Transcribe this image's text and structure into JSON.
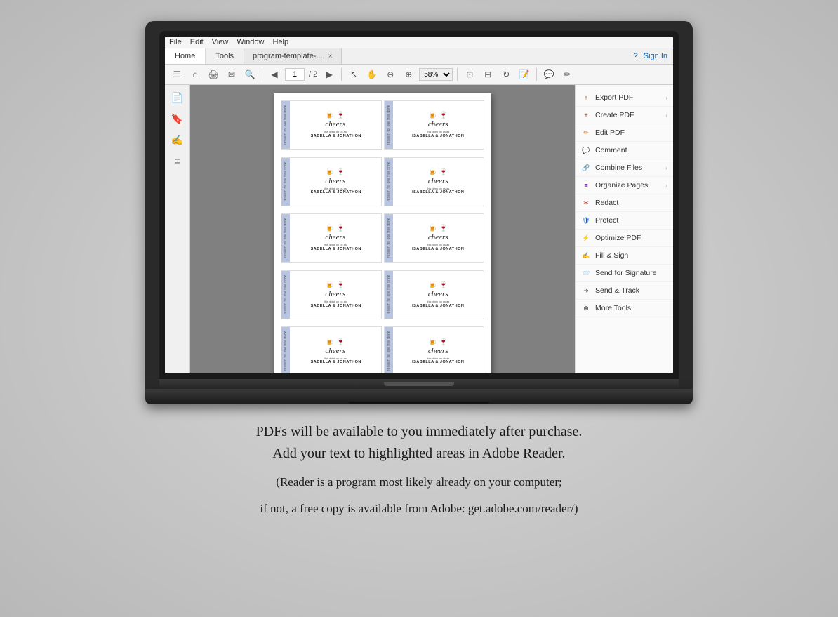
{
  "laptop": {
    "screen": {
      "menubar": {
        "items": [
          "File",
          "Edit",
          "View",
          "Window",
          "Help"
        ]
      },
      "tabs": {
        "home": "Home",
        "tools": "Tools",
        "file": "program-template-...",
        "close": "×"
      },
      "signin": {
        "help": "?",
        "label": "Sign In"
      },
      "toolbar": {
        "page_current": "1",
        "page_total": "/ 2",
        "zoom": "58%"
      },
      "right_panel": {
        "items": [
          {
            "label": "Export PDF",
            "icon": "📤",
            "color": "red",
            "has_arrow": true
          },
          {
            "label": "Create PDF",
            "icon": "📄",
            "color": "red",
            "has_arrow": true
          },
          {
            "label": "Edit PDF",
            "icon": "✏️",
            "color": "orange",
            "has_arrow": false
          },
          {
            "label": "Comment",
            "icon": "💬",
            "color": "yellow",
            "has_arrow": false
          },
          {
            "label": "Combine Files",
            "icon": "🔗",
            "color": "blue",
            "has_arrow": true
          },
          {
            "label": "Organize Pages",
            "icon": "📑",
            "color": "purple",
            "has_arrow": true
          },
          {
            "label": "Redact",
            "icon": "✂️",
            "color": "red",
            "has_arrow": false
          },
          {
            "label": "Protect",
            "icon": "🛡️",
            "color": "blue",
            "has_arrow": false
          },
          {
            "label": "Optimize PDF",
            "icon": "⚡",
            "color": "orange",
            "has_arrow": false
          },
          {
            "label": "Fill & Sign",
            "icon": "✍️",
            "color": "red",
            "has_arrow": false
          },
          {
            "label": "Send for Signature",
            "icon": "📨",
            "color": "teal",
            "has_arrow": false
          },
          {
            "label": "Send & Track",
            "icon": "➜",
            "color": "dark",
            "has_arrow": false
          },
          {
            "label": "More Tools",
            "icon": "⊕",
            "color": "dark",
            "has_arrow": false
          }
        ]
      },
      "tickets": [
        {
          "side_text": "redeem for one free drink",
          "name": "ISABELLA & JONATHON"
        },
        {
          "side_text": "redeem for one free drink",
          "name": "ISABELLA & JONATHON"
        },
        {
          "side_text": "redeem for one free drink",
          "name": "ISABELLA & JONATHON"
        },
        {
          "side_text": "redeem for one free drink",
          "name": "ISABELLA & JONATHON"
        },
        {
          "side_text": "redeem for one free drink",
          "name": "ISABELLA & JONATHON"
        },
        {
          "side_text": "redeem for one free drink",
          "name": "ISABELLA & JONATHON"
        },
        {
          "side_text": "redeem for one free drink",
          "name": "ISABELLA & JONATHON"
        },
        {
          "side_text": "redeem for one free drink",
          "name": "ISABELLA & JONATHON"
        },
        {
          "side_text": "redeem for one free drink",
          "name": "ISABELLA & JONATHON"
        },
        {
          "side_text": "redeem for one free drink",
          "name": "ISABELLA & JONATHON"
        }
      ]
    }
  },
  "below_text": {
    "line1": "PDFs will be available to you immediately after purchase.",
    "line2": "Add your text to highlighted areas in Adobe Reader.",
    "line3": "(Reader is a program most likely already on your computer;",
    "line4": "if not, a free copy is available from Adobe: get.adobe.com/reader/)"
  }
}
